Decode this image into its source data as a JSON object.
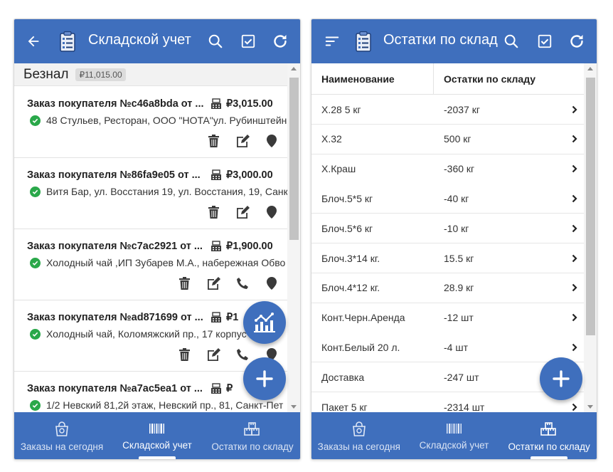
{
  "left": {
    "appbar": {
      "title": "Складской учет"
    },
    "group": {
      "title": "Безнал",
      "sum": "₽11,015.00"
    },
    "orders": [
      {
        "title": "Заказ покупателя №c46a8bda от ...",
        "amount": "₽3,015.00",
        "address": "48 Стульев, Ресторан, ООО \"НОТА\"ул. Рубинштейна",
        "phone": false
      },
      {
        "title": "Заказ покупателя №86fa9e05 от ...",
        "amount": "₽3,000.00",
        "address": "Витя Бар, ул. Восстания 19, ул. Восстания, 19, Санкт",
        "phone": false
      },
      {
        "title": "Заказ покупателя №c7ac2921 от ...",
        "amount": "₽1,900.00",
        "address": "Холодный чай ,ИП Зубарев М.А., набережная Обво",
        "phone": true
      },
      {
        "title": "Заказ покупателя №ad871699 от ...",
        "amount": "₽1",
        "address": "Холодный чай, Коломяжский пр., 17 корпус",
        "phone": true
      },
      {
        "title": "Заказ покупателя №a7ac5ea1 от ...",
        "amount": "₽",
        "address": "1/2 Невский 81,2й этаж, Невский пр., 81, Санкт-Пет",
        "phone": false
      }
    ],
    "nav": [
      {
        "label": "Заказы на сегодня",
        "icon": "shopping-bag-icon",
        "active": false
      },
      {
        "label": "Складской учет",
        "icon": "barcode-icon",
        "active": true
      },
      {
        "label": "Остатки по складу",
        "icon": "boxes-icon",
        "active": false
      }
    ]
  },
  "right": {
    "appbar": {
      "title": "Остатки по склад"
    },
    "columns": [
      "Наименование",
      "Остатки по складу"
    ],
    "rows": [
      [
        "Х.28 5 кг",
        "-2037 кг"
      ],
      [
        "Х.32",
        "500 кг"
      ],
      [
        "Х.Краш",
        "-360 кг"
      ],
      [
        "Блоч.5*5 кг",
        "-40 кг"
      ],
      [
        "Блоч.5*6 кг",
        "-10 кг"
      ],
      [
        "Блоч.3*14 кг.",
        "15.5 кг"
      ],
      [
        "Блоч.4*12 кг.",
        "28.9 кг"
      ],
      [
        "Конт.Черн.Аренда",
        "-12 шт"
      ],
      [
        "Конт.Белый 20 л.",
        "-4 шт"
      ],
      [
        "Доставка",
        "-247 шт"
      ],
      [
        "Пакет 5 кг",
        "-2314 шт"
      ]
    ],
    "nav": [
      {
        "label": "Заказы на сегодня",
        "icon": "shopping-bag-icon",
        "active": false
      },
      {
        "label": "Складской учет",
        "icon": "barcode-icon",
        "active": false
      },
      {
        "label": "Остатки по складу",
        "icon": "boxes-icon",
        "active": true
      }
    ]
  },
  "colors": {
    "primary": "#3f6fbd",
    "success": "#2aa84a",
    "icon_dark": "#3a3a3a"
  }
}
